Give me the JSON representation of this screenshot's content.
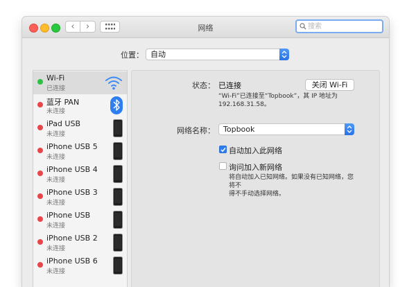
{
  "window": {
    "title": "网络"
  },
  "search": {
    "placeholder": "搜索"
  },
  "location": {
    "label": "位置：",
    "value": "自动"
  },
  "sidebar": {
    "items": [
      {
        "name": "Wi-Fi",
        "status": "已连接",
        "dot": "green",
        "icon": "wifi-icon"
      },
      {
        "name": "蓝牙 PAN",
        "status": "未连接",
        "dot": "red",
        "icon": "bluetooth-icon"
      },
      {
        "name": "iPad USB",
        "status": "未连接",
        "dot": "red",
        "icon": "iphone-icon"
      },
      {
        "name": "iPhone USB 5",
        "status": "未连接",
        "dot": "red",
        "icon": "iphone-icon"
      },
      {
        "name": "iPhone USB 4",
        "status": "未连接",
        "dot": "red",
        "icon": "iphone-icon"
      },
      {
        "name": "iPhone USB 3",
        "status": "未连接",
        "dot": "red",
        "icon": "iphone-icon"
      },
      {
        "name": "iPhone USB",
        "status": "未连接",
        "dot": "red",
        "icon": "iphone-icon"
      },
      {
        "name": "iPhone USB 2",
        "status": "未连接",
        "dot": "red",
        "icon": "iphone-icon"
      },
      {
        "name": "iPhone USB 6",
        "status": "未连接",
        "dot": "red",
        "icon": "iphone-icon"
      }
    ]
  },
  "detail": {
    "status_label": "状态：",
    "status_value": "已连接",
    "wifi_off_button": "关闭 Wi-Fi",
    "status_desc_line1": "“Wi-Fi”已连接至“Topbook”，其 IP 地址为",
    "status_desc_line2": "192.168.31.58。",
    "network_name_label": "网络名称：",
    "network_name_value": "Topbook",
    "auto_join_label": "自动加入此网络",
    "auto_join_checked": true,
    "ask_join_label": "询问加入新网络",
    "ask_join_checked": false,
    "note_line1": "将自动加入已知网络。如果没有已知网络，您将不",
    "note_line2": "得不手动选择网络。"
  },
  "colors": {
    "accent": "#2f7ef0",
    "connected": "#2cc144",
    "disconnected": "#e8464a"
  }
}
